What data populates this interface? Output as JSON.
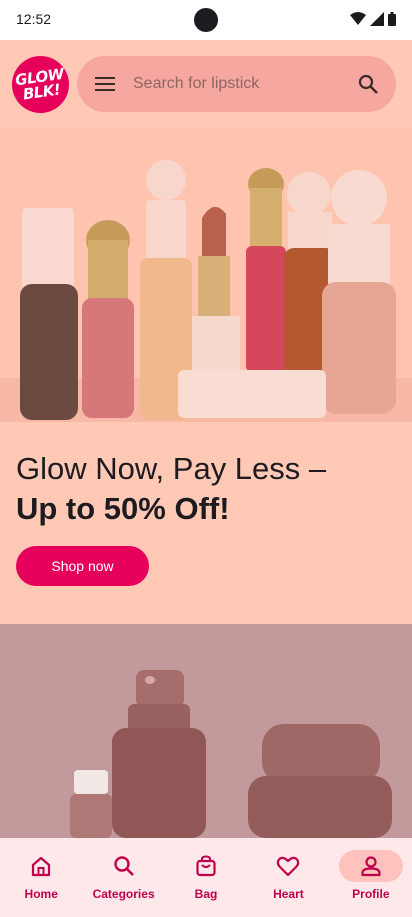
{
  "status": {
    "time": "12:52"
  },
  "logo": {
    "line1": "GLOW",
    "line2": "BLK!"
  },
  "search": {
    "placeholder": "Search for lipstick",
    "menu_icon": "menu-icon",
    "search_icon": "search-icon"
  },
  "hero": {
    "headline_regular": "Glow Now, Pay Less –",
    "headline_bold": "Up to 50% Off!",
    "cta_label": "Shop now"
  },
  "bottom_nav": {
    "items": [
      {
        "label": "Home",
        "icon": "home-icon",
        "active": false
      },
      {
        "label": "Categories",
        "icon": "search-icon",
        "active": false
      },
      {
        "label": "Bag",
        "icon": "bag-icon",
        "active": false
      },
      {
        "label": "Heart",
        "icon": "heart-icon",
        "active": false
      },
      {
        "label": "Profile",
        "icon": "profile-icon",
        "active": true
      }
    ]
  },
  "colors": {
    "accent": "#e6005c",
    "hero_background": "#ffc9b6",
    "search_background": "#f6a8a0",
    "nav_background": "#ffe8ea",
    "nav_active_indicator": "#ffc2bc"
  }
}
